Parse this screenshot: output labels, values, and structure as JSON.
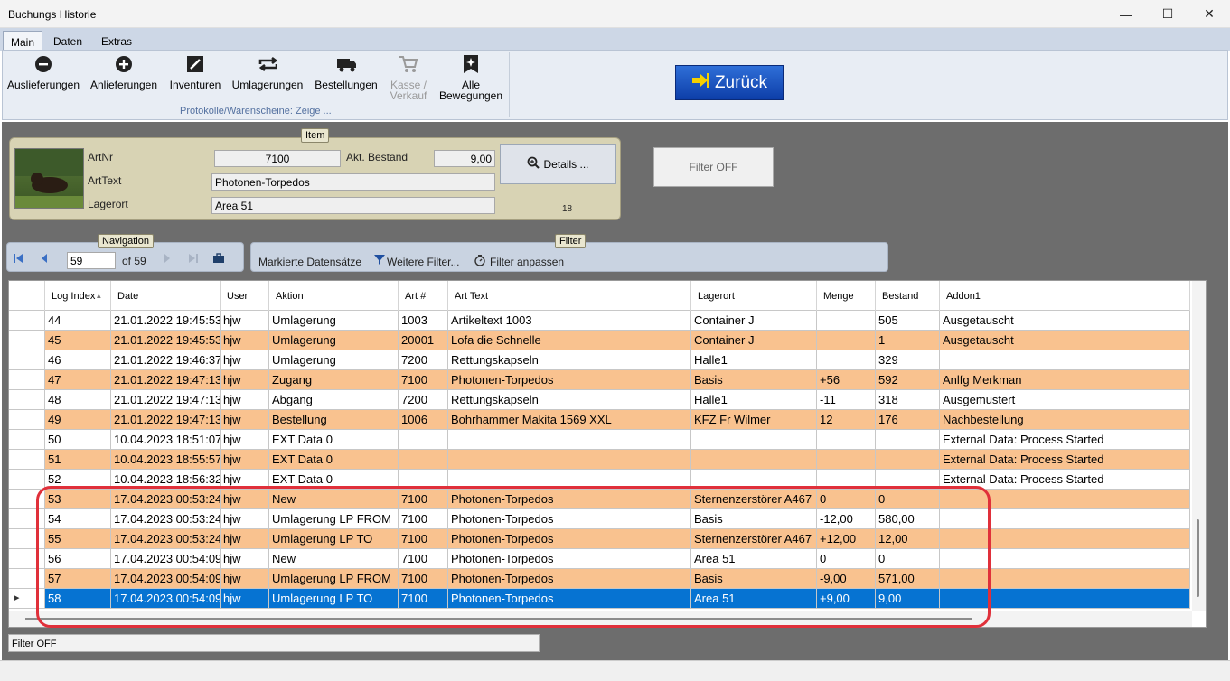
{
  "window": {
    "title": "Buchungs Historie"
  },
  "tabs": [
    "Main",
    "Daten",
    "Extras"
  ],
  "ribbon": {
    "buttons": [
      {
        "label": "Auslieferungen",
        "icon": "minus-circle-icon"
      },
      {
        "label": "Anlieferungen",
        "icon": "plus-circle-icon"
      },
      {
        "label": "Inventuren",
        "icon": "edit-square-icon"
      },
      {
        "label": "Umlagerungen",
        "icon": "repeat-icon"
      },
      {
        "label": "Bestellungen",
        "icon": "truck-icon"
      },
      {
        "label": "Kasse / Verkauf",
        "icon": "cart-icon"
      },
      {
        "label": "Alle Bewegungen",
        "icon": "sparkle-bookmark-icon"
      }
    ],
    "group_label": "Protokolle/Warenscheine: Zeige ..."
  },
  "zurueck_label": "Zurück",
  "item": {
    "legend": "Item",
    "artnr_label": "ArtNr",
    "artnr": "7100",
    "bestand_label": "Akt. Bestand",
    "bestand": "9,00",
    "arttext_label": "ArtText",
    "arttext": "Photonen-Torpedos",
    "lagerort_label": "Lagerort",
    "lagerort": "Area 51",
    "details_label": "Details ...",
    "count": "18"
  },
  "filter_off_button": "Filter OFF",
  "navigation": {
    "legend": "Navigation",
    "position": "59",
    "of_label": "of 59"
  },
  "filter": {
    "legend": "Filter",
    "marked": "Markierte Datensätze",
    "more": "Weitere Filter...",
    "adjust": "Filter anpassen"
  },
  "table": {
    "columns": [
      "Log Index",
      "Date",
      "User",
      "Aktion",
      "Art #",
      "Art Text",
      "Lagerort",
      "Menge",
      "Bestand",
      "Addon1"
    ],
    "rows": [
      [
        "44",
        "21.01.2022 19:45:53",
        "hjw",
        "Umlagerung",
        "1003",
        "Artikeltext 1003",
        "Container J",
        "",
        "505",
        "Ausgetauscht"
      ],
      [
        "45",
        "21.01.2022 19:45:53",
        "hjw",
        "Umlagerung",
        "20001",
        "Lofa die Schnelle",
        "Container J",
        "",
        "1",
        "Ausgetauscht"
      ],
      [
        "46",
        "21.01.2022 19:46:37",
        "hjw",
        "Umlagerung",
        "7200",
        "Rettungskapseln",
        "Halle1",
        "",
        "329",
        ""
      ],
      [
        "47",
        "21.01.2022 19:47:13",
        "hjw",
        "Zugang",
        "7100",
        "Photonen-Torpedos",
        "Basis",
        "+56",
        "592",
        "Anlfg Merkman"
      ],
      [
        "48",
        "21.01.2022 19:47:13",
        "hjw",
        "Abgang",
        "7200",
        "Rettungskapseln",
        "Halle1",
        "-11",
        "318",
        "Ausgemustert"
      ],
      [
        "49",
        "21.01.2022 19:47:13",
        "hjw",
        "Bestellung",
        "1006",
        "Bohrhammer Makita 1569 XXL",
        "KFZ Fr Wilmer",
        "12",
        "176",
        "Nachbestellung"
      ],
      [
        "50",
        "10.04.2023 18:51:07",
        "hjw",
        "EXT Data 0",
        "",
        "",
        "",
        "",
        "",
        "External Data: Process Started"
      ],
      [
        "51",
        "10.04.2023 18:55:57",
        "hjw",
        "EXT Data 0",
        "",
        "",
        "",
        "",
        "",
        "External Data: Process Started"
      ],
      [
        "52",
        "10.04.2023 18:56:32",
        "hjw",
        "EXT Data 0",
        "",
        "",
        "",
        "",
        "",
        "External Data: Process Started"
      ],
      [
        "53",
        "17.04.2023 00:53:24",
        "hjw",
        "New",
        "7100",
        "Photonen-Torpedos",
        "Sternenzerstörer A467",
        "0",
        "0",
        ""
      ],
      [
        "54",
        "17.04.2023 00:53:24",
        "hjw",
        "Umlagerung LP FROM",
        "7100",
        "Photonen-Torpedos",
        "Basis",
        "-12,00",
        "580,00",
        ""
      ],
      [
        "55",
        "17.04.2023 00:53:24",
        "hjw",
        "Umlagerung LP TO",
        "7100",
        "Photonen-Torpedos",
        "Sternenzerstörer A467",
        "+12,00",
        "12,00",
        ""
      ],
      [
        "56",
        "17.04.2023 00:54:09",
        "hjw",
        "New",
        "7100",
        "Photonen-Torpedos",
        "Area 51",
        "0",
        "0",
        ""
      ],
      [
        "57",
        "17.04.2023 00:54:09",
        "hjw",
        "Umlagerung LP FROM",
        "7100",
        "Photonen-Torpedos",
        "Basis",
        "-9,00",
        "571,00",
        ""
      ],
      [
        "58",
        "17.04.2023 00:54:09",
        "hjw",
        "Umlagerung LP TO",
        "7100",
        "Photonen-Torpedos",
        "Area 51",
        "+9,00",
        "9,00",
        ""
      ]
    ],
    "selected_index": "58"
  },
  "status": "Filter OFF"
}
